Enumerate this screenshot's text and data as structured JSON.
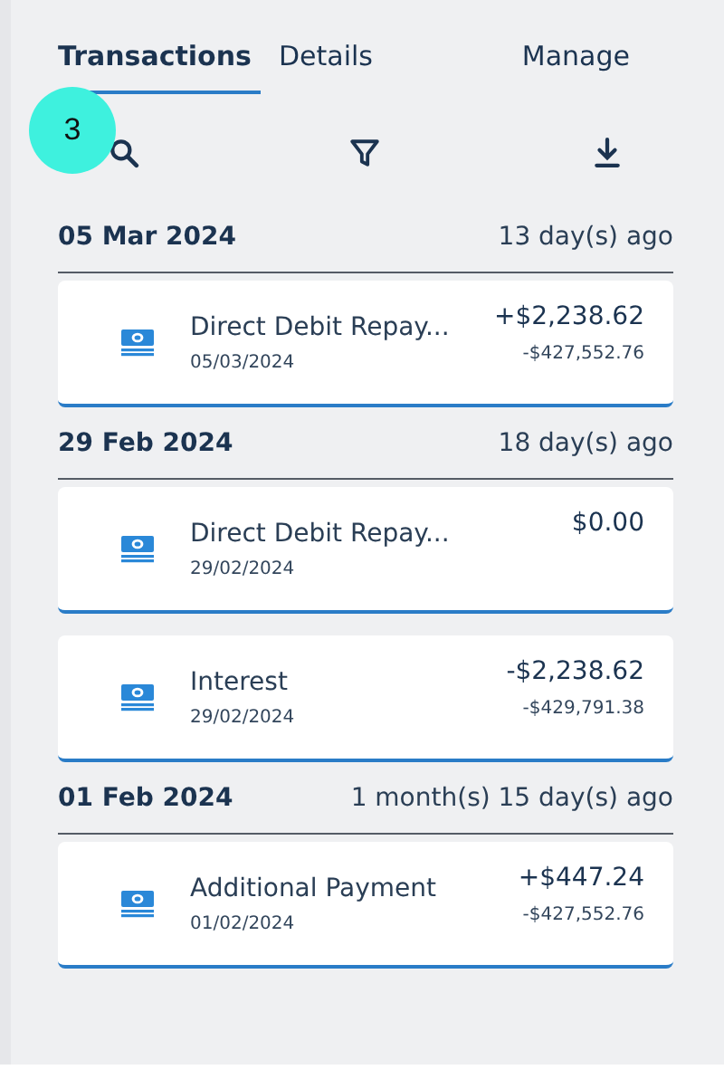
{
  "tabs": [
    {
      "label": "Transactions",
      "selected": true
    },
    {
      "label": "Details",
      "selected": false
    },
    {
      "label": "Manage",
      "selected": false
    }
  ],
  "badge": "3",
  "groups": [
    {
      "date": "05 Mar 2024",
      "ago": "13 day(s) ago",
      "transactions": [
        {
          "title": "Direct Debit Repay...",
          "date": "05/03/2024",
          "amount": "+$2,238.62",
          "balance": "-$427,552.76"
        }
      ]
    },
    {
      "date": "29 Feb 2024",
      "ago": "18 day(s) ago",
      "transactions": [
        {
          "title": "Direct Debit Repay...",
          "date": "29/02/2024",
          "amount": "$0.00"
        },
        {
          "title": "Interest",
          "date": "29/02/2024",
          "amount": "-$2,238.62",
          "balance": "-$429,791.38"
        }
      ]
    },
    {
      "date": "01 Feb 2024",
      "ago": "1 month(s) 15 day(s) ago",
      "transactions": [
        {
          "title": "Additional Payment",
          "date": "01/02/2024",
          "amount": "+$447.24",
          "balance": "-$427,552.76"
        }
      ]
    }
  ]
}
